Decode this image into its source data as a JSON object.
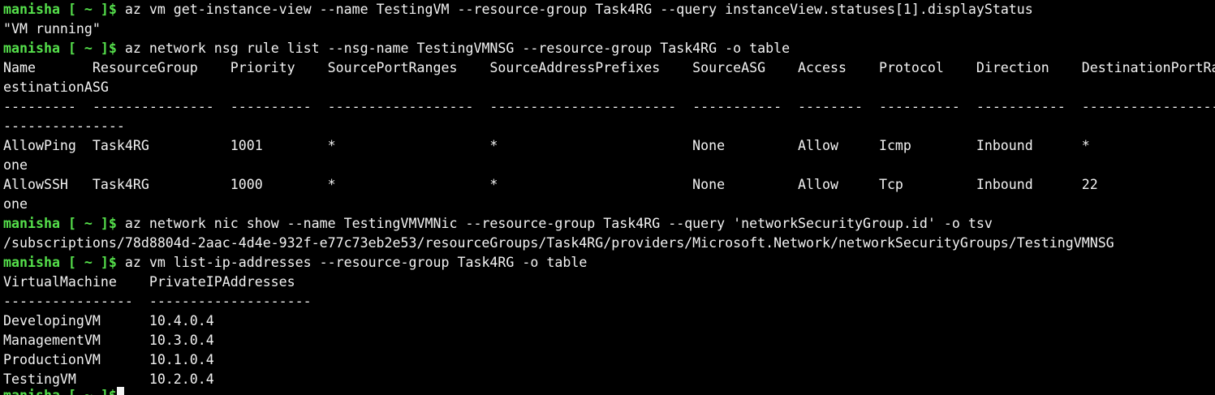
{
  "prompt": {
    "user": "manisha",
    "bracket": " [ ~ ]$",
    "color": "#55e04b"
  },
  "lines": [
    {
      "type": "prompt",
      "cmd": " az vm get-instance-view --name TestingVM --resource-group Task4RG --query instanceView.statuses[1].displayStatus"
    },
    {
      "type": "out",
      "text": "\"VM running\""
    },
    {
      "type": "prompt",
      "cmd": " az network nsg rule list --nsg-name TestingVMNSG --resource-group Task4RG -o table"
    },
    {
      "type": "out",
      "text": "Name       ResourceGroup    Priority    SourcePortRanges    SourceAddressPrefixes    SourceASG    Access    Protocol    Direction    DestinationPortRanges"
    },
    {
      "type": "out",
      "text": "estinationASG"
    },
    {
      "type": "out",
      "text": "---------  ---------------  ----------  ------------------  -----------------------  -----------  --------  ----------  -----------  ---------------------"
    },
    {
      "type": "out",
      "text": "---------------"
    },
    {
      "type": "out",
      "text": "AllowPing  Task4RG          1001        *                   *                        None         Allow     Icmp        Inbound      *"
    },
    {
      "type": "out",
      "text": "one"
    },
    {
      "type": "out",
      "text": "AllowSSH   Task4RG          1000        *                   *                        None         Allow     Tcp         Inbound      22"
    },
    {
      "type": "out",
      "text": "one"
    },
    {
      "type": "prompt",
      "cmd": " az network nic show --name TestingVMVMNic --resource-group Task4RG --query 'networkSecurityGroup.id' -o tsv"
    },
    {
      "type": "out",
      "text": "/subscriptions/78d8804d-2aac-4d4e-932f-e77c73eb2e53/resourceGroups/Task4RG/providers/Microsoft.Network/networkSecurityGroups/TestingVMNSG"
    },
    {
      "type": "prompt",
      "cmd": " az vm list-ip-addresses --resource-group Task4RG -o table"
    },
    {
      "type": "out",
      "text": "VirtualMachine    PrivateIPAddresses"
    },
    {
      "type": "out",
      "text": "----------------  --------------------"
    },
    {
      "type": "out",
      "text": "DevelopingVM      10.4.0.4"
    },
    {
      "type": "out",
      "text": "ManagementVM      10.3.0.4"
    },
    {
      "type": "out",
      "text": "ProductionVM      10.1.0.4"
    },
    {
      "type": "out",
      "text": "TestingVM         10.2.0.4"
    }
  ]
}
